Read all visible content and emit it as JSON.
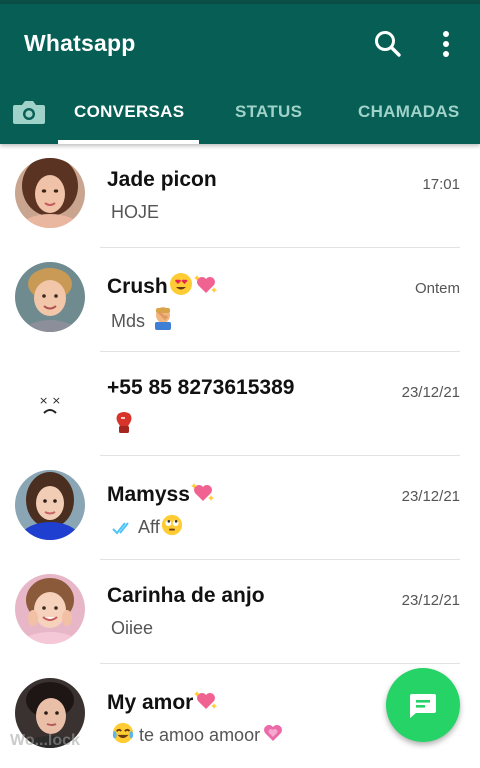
{
  "app": {
    "title": "Whatsapp"
  },
  "tabs": [
    {
      "label": "CONVERSAS",
      "active": true
    },
    {
      "label": "STATUS",
      "active": false
    },
    {
      "label": "CHAMADAS",
      "active": false
    }
  ],
  "colors": {
    "header": "#075e54",
    "accent_fab": "#25d366",
    "read_ticks": "#4fc3f7"
  },
  "chats": [
    {
      "name": "Jade picon",
      "time": "17:01",
      "preview": "HOJE",
      "name_emoji": [],
      "preview_emoji": []
    },
    {
      "name": "Crush",
      "time": "Ontem",
      "preview": "Mds",
      "name_emoji": [
        "heart-eyes",
        "sparkling-heart"
      ],
      "preview_emoji": [
        "facepalm"
      ]
    },
    {
      "name": "+55 85 8273615389",
      "time": "23/12/21",
      "preview": "",
      "name_emoji": [],
      "preview_emoji": [
        "boxing-glove"
      ]
    },
    {
      "name": "Mamyss",
      "time": "23/12/21",
      "preview": "Aff",
      "name_emoji": [
        "sparkling-heart"
      ],
      "preview_emoji": [
        "rolling-eyes"
      ],
      "read_receipt": true
    },
    {
      "name": "Carinha de anjo",
      "time": "23/12/21",
      "preview": "Oiiee",
      "name_emoji": [],
      "preview_emoji": []
    },
    {
      "name": "My amor",
      "time": "",
      "preview": "te amoo amoor",
      "name_emoji": [
        "sparkling-heart"
      ],
      "preview_emoji": [
        "joy",
        "growing-heart"
      ]
    }
  ],
  "watermark": "Wo...lock"
}
